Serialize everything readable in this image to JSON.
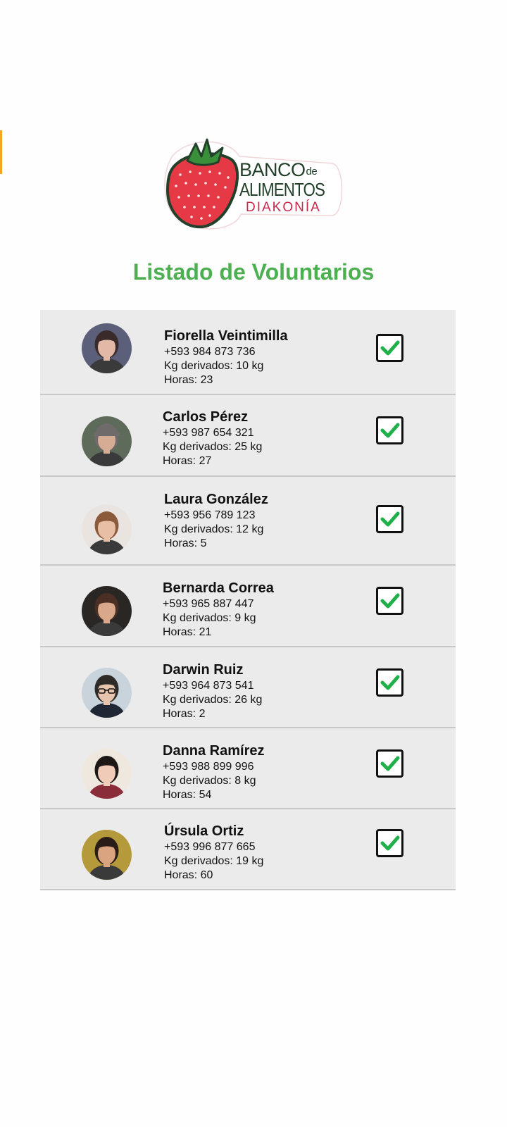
{
  "brand": {
    "name_line1": "BANCO",
    "name_de": "de",
    "name_line2": "ALIMENTOS",
    "name_line3": "DIAKONÍA"
  },
  "page": {
    "title": "Listado de Voluntarios"
  },
  "colors": {
    "title": "#4caf50",
    "check": "#1fb049",
    "row_bg": "#ebebeb",
    "logo_red": "#e63946",
    "logo_dark": "#22402a"
  },
  "volunteers": [
    {
      "name": "Fiorella Veintimilla",
      "phone": "+593 984 873 736",
      "kg": "Kg derivados: 10 kg",
      "hours": "Horas: 23",
      "checked": true,
      "avatar_icon": "woman-profile-avatar"
    },
    {
      "name": "Carlos Pérez",
      "phone": "+593 987 654 321",
      "kg": "Kg derivados: 25 kg",
      "hours": "Horas: 27",
      "checked": true,
      "avatar_icon": "man-cap-avatar"
    },
    {
      "name": "Laura González",
      "phone": "+593 956 789 123",
      "kg": "Kg derivados: 12 kg",
      "hours": "Horas: 5",
      "checked": true,
      "avatar_icon": "woman-avatar"
    },
    {
      "name": "Bernarda Correa",
      "phone": "+593 965 887 447",
      "kg": "Kg derivados: 9 kg",
      "hours": "Horas: 21",
      "checked": true,
      "avatar_icon": "woman-avatar"
    },
    {
      "name": "Darwin Ruiz",
      "phone": "+593 964 873 541",
      "kg": "Kg derivados: 26 kg",
      "hours": "Horas: 2",
      "checked": true,
      "avatar_icon": "man-glasses-avatar"
    },
    {
      "name": "Danna Ramírez",
      "phone": "+593 988 899 996",
      "kg": "Kg derivados: 8 kg",
      "hours": "Horas: 54",
      "checked": true,
      "avatar_icon": "woman-avatar"
    },
    {
      "name": "Úrsula Ortiz",
      "phone": "+593 996 877 665",
      "kg": "Kg derivados: 19 kg",
      "hours": "Horas: 60",
      "checked": true,
      "avatar_icon": "woman-avatar"
    }
  ]
}
